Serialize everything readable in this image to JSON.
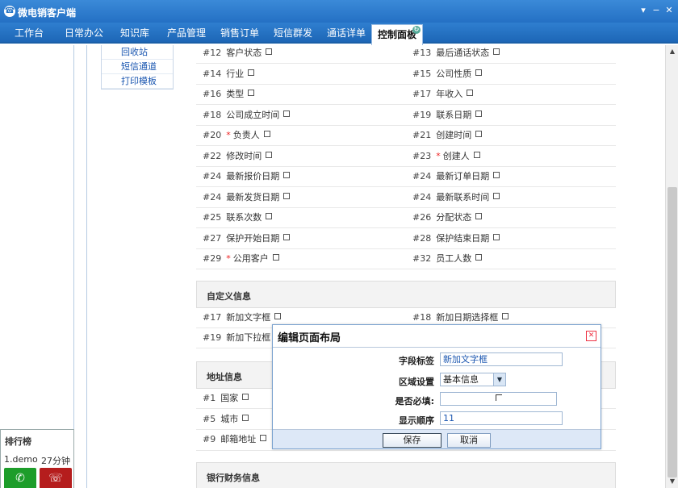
{
  "app": {
    "title": "微电销客户端",
    "logo_icon": "phone-logo-icon"
  },
  "tabs": [
    {
      "label": "工作台"
    },
    {
      "label": "日常办公"
    },
    {
      "label": "知识库"
    },
    {
      "label": "产品管理"
    },
    {
      "label": "销售订单"
    },
    {
      "label": "短信群发"
    },
    {
      "label": "通话详单"
    },
    {
      "label": "控制面板",
      "active": true
    }
  ],
  "submenu": [
    "回收站",
    "短信通道",
    "打印模板"
  ],
  "basic_fields": [
    {
      "num": "#12",
      "label": "客户状态",
      "required": false
    },
    {
      "num": "#13",
      "label": "最后通话状态",
      "required": false
    },
    {
      "num": "#14",
      "label": "行业",
      "required": false
    },
    {
      "num": "#15",
      "label": "公司性质",
      "required": false
    },
    {
      "num": "#16",
      "label": "类型",
      "required": false
    },
    {
      "num": "#17",
      "label": "年收入",
      "required": false
    },
    {
      "num": "#18",
      "label": "公司成立时间",
      "required": false
    },
    {
      "num": "#19",
      "label": "联系日期",
      "required": false
    },
    {
      "num": "#20",
      "label": "负责人",
      "required": true
    },
    {
      "num": "#21",
      "label": "创建时间",
      "required": false
    },
    {
      "num": "#22",
      "label": "修改时间",
      "required": false
    },
    {
      "num": "#23",
      "label": "创建人",
      "required": true
    },
    {
      "num": "#24",
      "label": "最新报价日期",
      "required": false
    },
    {
      "num": "#24",
      "label": "最新订单日期",
      "required": false
    },
    {
      "num": "#24",
      "label": "最新发货日期",
      "required": false
    },
    {
      "num": "#24",
      "label": "最新联系时间",
      "required": false
    },
    {
      "num": "#25",
      "label": "联系次数",
      "required": false
    },
    {
      "num": "#26",
      "label": "分配状态",
      "required": false
    },
    {
      "num": "#27",
      "label": "保护开始日期",
      "required": false
    },
    {
      "num": "#28",
      "label": "保护结束日期",
      "required": false
    },
    {
      "num": "#29",
      "label": "公用客户",
      "required": true
    },
    {
      "num": "#32",
      "label": "员工人数",
      "required": false
    }
  ],
  "sections": {
    "custom": "自定义信息",
    "address": "地址信息",
    "bank": "银行财务信息"
  },
  "custom_fields": [
    {
      "num": "#17",
      "label": "新加文字框"
    },
    {
      "num": "#18",
      "label": "新加日期选择框"
    },
    {
      "num": "#19",
      "label": "新加下拉框"
    }
  ],
  "address_fields": [
    {
      "num": "#1",
      "label": "国家"
    },
    {
      "num": "#5",
      "label": "城市"
    },
    {
      "num": "#9",
      "label": "邮箱地址"
    }
  ],
  "ranking": {
    "title": "排行榜",
    "name": "1.demo",
    "time": "27分钟"
  },
  "dialog": {
    "title": "编辑页面布局",
    "field_label_label": "字段标签",
    "field_label_value": "新加文字框",
    "area_label": "区域设置",
    "area_value": "基本信息",
    "required_label": "是否必填:",
    "order_label": "显示顺序",
    "order_value": "11",
    "save_label": "保存",
    "cancel_label": "取消"
  }
}
